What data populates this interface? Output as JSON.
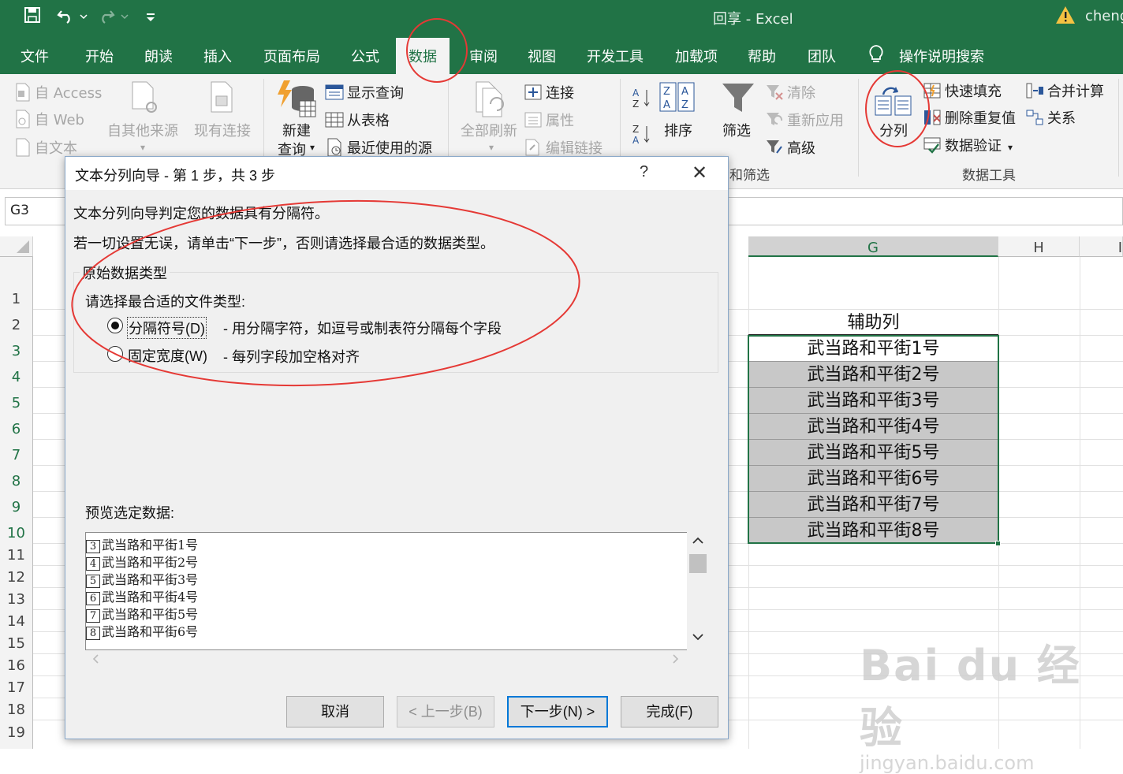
{
  "window": {
    "title": "回享  -  Excel",
    "user": "cheng"
  },
  "colors": {
    "brand": "#217346",
    "annotation": "#e53935",
    "selection": "#217346"
  },
  "tabs": [
    {
      "label": "文件"
    },
    {
      "label": "开始"
    },
    {
      "label": "朗读"
    },
    {
      "label": "插入"
    },
    {
      "label": "页面布局"
    },
    {
      "label": "公式"
    },
    {
      "label": "数据"
    },
    {
      "label": "审阅"
    },
    {
      "label": "视图"
    },
    {
      "label": "开发工具"
    },
    {
      "label": "加载项"
    },
    {
      "label": "帮助"
    },
    {
      "label": "团队"
    }
  ],
  "tell_me": "操作说明搜索",
  "ribbon": {
    "get_external": {
      "access": "自 Access",
      "web": "自 Web",
      "text": "自文本",
      "other": "自其他来源",
      "existing": "现有连接"
    },
    "get_transform": {
      "new_query_1": "新建",
      "new_query_2": "查询",
      "show_queries": "显示查询",
      "from_table": "从表格",
      "recent_sources": "最近使用的源"
    },
    "connections": {
      "refresh_all": "全部刷新",
      "connections": "连接",
      "properties": "属性",
      "edit_links": "编辑链接"
    },
    "sort_filter": {
      "sort": "排序",
      "filter": "筛选",
      "clear": "清除",
      "reapply": "重新应用",
      "advanced": "高级",
      "group": "和筛选"
    },
    "data_tools": {
      "text_to_columns": "分列",
      "flash_fill": "快速填充",
      "remove_dup": "删除重复值",
      "validation": "数据验证",
      "consolidate": "合并计算",
      "relationships": "关系",
      "group": "数据工具"
    }
  },
  "namebox": "G3",
  "grid": {
    "columns": {
      "G": "G",
      "H": "H",
      "I": "I"
    },
    "rows": [
      "1",
      "2",
      "3",
      "4",
      "5",
      "6",
      "7",
      "8",
      "9",
      "10",
      "11",
      "12",
      "13",
      "14",
      "15",
      "16",
      "17",
      "18",
      "19"
    ],
    "header_cell": "辅助列",
    "cells": [
      "武当路和平街1号",
      "武当路和平街2号",
      "武当路和平街3号",
      "武当路和平街4号",
      "武当路和平街5号",
      "武当路和平街6号",
      "武当路和平街7号",
      "武当路和平街8号"
    ]
  },
  "dialog": {
    "title": "文本分列向导 - 第 1 步，共 3 步",
    "help": "?",
    "close": "✕",
    "line1": "文本分列向导判定您的数据具有分隔符。",
    "line2": "若一切设置无误，请单击“下一步”，否则请选择最合适的数据类型。",
    "group_label": "原始数据类型",
    "prompt": "请选择最合适的文件类型:",
    "options": [
      {
        "label": "分隔符号(D)",
        "desc": "- 用分隔字符，如逗号或制表符分隔每个字段",
        "selected": true
      },
      {
        "label": "固定宽度(W)",
        "desc": "- 每列字段加空格对齐",
        "selected": false
      }
    ],
    "preview_label": "预览选定数据:",
    "preview_rows": [
      {
        "num": "3",
        "text": "武当路和平街1号"
      },
      {
        "num": "4",
        "text": "武当路和平街2号"
      },
      {
        "num": "5",
        "text": "武当路和平街3号"
      },
      {
        "num": "6",
        "text": "武当路和平街4号"
      },
      {
        "num": "7",
        "text": "武当路和平街5号"
      },
      {
        "num": "8",
        "text": "武当路和平街6号"
      }
    ],
    "buttons": {
      "cancel": "取消",
      "back": "< 上一步(B)",
      "next": "下一步(N) >",
      "finish": "完成(F)"
    }
  },
  "watermark": {
    "logo": "Bai du 经验",
    "url": "jingyan.baidu.com"
  }
}
